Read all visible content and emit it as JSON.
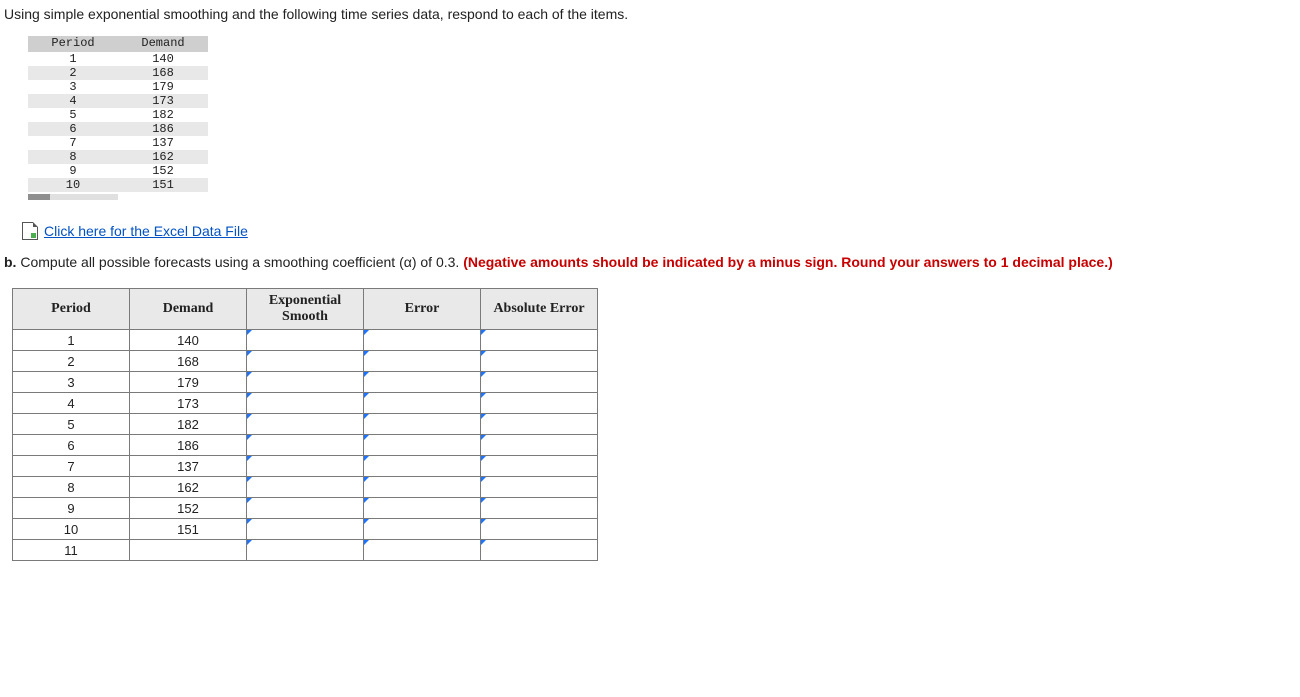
{
  "intro": "Using simple exponential smoothing and the following time series data, respond to each of the items.",
  "data_table": {
    "headers": [
      "Period",
      "Demand"
    ],
    "rows": [
      {
        "period": "1",
        "demand": "140"
      },
      {
        "period": "2",
        "demand": "168"
      },
      {
        "period": "3",
        "demand": "179"
      },
      {
        "period": "4",
        "demand": "173"
      },
      {
        "period": "5",
        "demand": "182"
      },
      {
        "period": "6",
        "demand": "186"
      },
      {
        "period": "7",
        "demand": "137"
      },
      {
        "period": "8",
        "demand": "162"
      },
      {
        "period": "9",
        "demand": "152"
      },
      {
        "period": "10",
        "demand": "151"
      }
    ]
  },
  "excel_link_text": " Click here for the Excel Data File",
  "partb": {
    "label": "b.",
    "text": " Compute all possible forecasts using a smoothing coefficient (α) of 0.3. ",
    "red1": "(Negative amounts should be indicated by a minus sign. Round your answers to 1 decimal place.)"
  },
  "answer_table": {
    "headers": [
      "Period",
      "Demand",
      "Exponential Smooth",
      "Error",
      "Absolute Error"
    ],
    "rows": [
      {
        "period": "1",
        "demand": "140"
      },
      {
        "period": "2",
        "demand": "168"
      },
      {
        "period": "3",
        "demand": "179"
      },
      {
        "period": "4",
        "demand": "173"
      },
      {
        "period": "5",
        "demand": "182"
      },
      {
        "period": "6",
        "demand": "186"
      },
      {
        "period": "7",
        "demand": "137"
      },
      {
        "period": "8",
        "demand": "162"
      },
      {
        "period": "9",
        "demand": "152"
      },
      {
        "period": "10",
        "demand": "151"
      },
      {
        "period": "11",
        "demand": ""
      }
    ]
  }
}
